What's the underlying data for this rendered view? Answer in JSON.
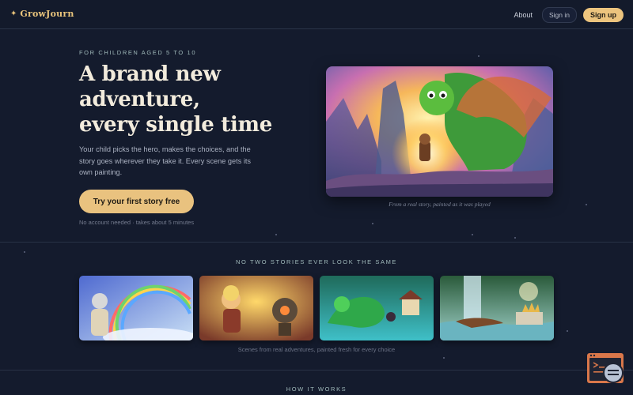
{
  "header": {
    "brand_icon": "sparkle-icon",
    "brand_name": "GrowJourn",
    "about": "About",
    "sign_in": "Sign in",
    "sign_up": "Sign up"
  },
  "hero": {
    "eyebrow": "FOR CHILDREN AGED 5 TO 10",
    "headline": [
      "A brand new",
      "adventure,",
      "every single time"
    ],
    "subtext": "Your child picks the hero, makes the choices, and the story goes wherever they take it. Every scene gets its own painting.",
    "cta": "Try your first story free",
    "cta_note": "No account needed · takes about 5 minutes",
    "image_caption": "From a real story, painted as it was played"
  },
  "gallery": {
    "title": "NO TWO STORIES EVER LOOK THE SAME",
    "caption": "Scenes from real adventures, painted fresh for every choice"
  },
  "how_it_works": {
    "title": "HOW IT WORKS"
  },
  "colors": {
    "background": "#141b2d",
    "accent": "#e9c27f",
    "eyebrow": "#9fb8b9"
  }
}
